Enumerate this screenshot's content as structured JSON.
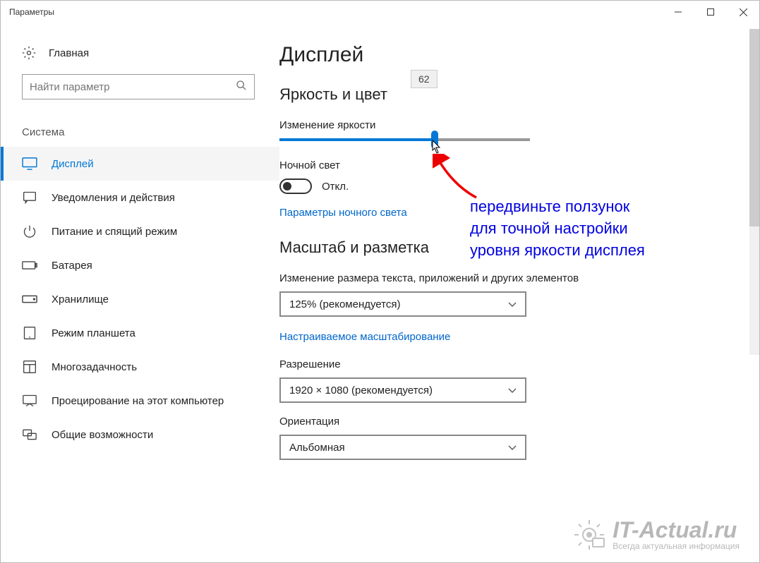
{
  "window": {
    "title": "Параметры"
  },
  "sidebar": {
    "home_label": "Главная",
    "search_placeholder": "Найти параметр",
    "section_title": "Система",
    "items": [
      {
        "label": "Дисплей",
        "active": true
      },
      {
        "label": "Уведомления и действия",
        "active": false
      },
      {
        "label": "Питание и спящий режим",
        "active": false
      },
      {
        "label": "Батарея",
        "active": false
      },
      {
        "label": "Хранилище",
        "active": false
      },
      {
        "label": "Режим планшета",
        "active": false
      },
      {
        "label": "Многозадачность",
        "active": false
      },
      {
        "label": "Проецирование на этот компьютер",
        "active": false
      },
      {
        "label": "Общие возможности",
        "active": false
      }
    ]
  },
  "main": {
    "page_title": "Дисплей",
    "group_brightness": "Яркость и цвет",
    "brightness_label": "Изменение яркости",
    "brightness_value": "62",
    "nightlight_label": "Ночной свет",
    "nightlight_state": "Откл.",
    "nightlight_link": "Параметры ночного света",
    "group_scale": "Масштаб и разметка",
    "scale_label": "Изменение размера текста, приложений и других элементов",
    "scale_value": "125% (рекомендуется)",
    "scale_link": "Настраиваемое масштабирование",
    "resolution_label": "Разрешение",
    "resolution_value": "1920 × 1080 (рекомендуется)",
    "orientation_label": "Ориентация",
    "orientation_value": "Альбомная"
  },
  "annotation": {
    "line1": "передвиньте ползунок",
    "line2": "для точной настройки",
    "line3": "уровня яркости дисплея"
  },
  "watermark": {
    "main": "IT-Actual.ru",
    "sub": "Всегда актуальная информация"
  }
}
